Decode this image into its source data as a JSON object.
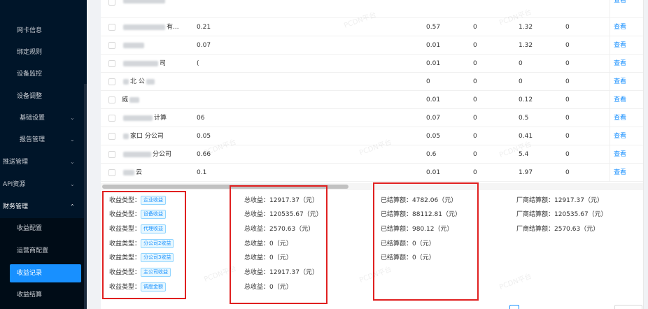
{
  "sidebar": {
    "items": [
      {
        "label": "网卡信息"
      },
      {
        "label": "绑定规则"
      },
      {
        "label": "设备监控"
      },
      {
        "label": "设备调整"
      },
      {
        "label": "基础设置"
      },
      {
        "label": "报告管理"
      },
      {
        "label": "推送管理"
      },
      {
        "label": "API资源"
      },
      {
        "label": "财务管理"
      },
      {
        "label": "收益配置"
      },
      {
        "label": "运营商配置"
      },
      {
        "label": "收益记录"
      },
      {
        "label": "收益结算"
      }
    ]
  },
  "table": {
    "action_label": "查看",
    "rows": [
      {
        "name": "有...",
        "c1": "0.21",
        "c2": "0.57",
        "c3": "0",
        "c4": "1.32",
        "c5": "0"
      },
      {
        "name": "",
        "c1": "0.07",
        "c2": "0.01",
        "c3": "0",
        "c4": "1.32",
        "c5": "0"
      },
      {
        "name": "司",
        "c1": "(",
        "c2": "0.01",
        "c3": "0",
        "c4": "0",
        "c5": "0"
      },
      {
        "name": "北 公",
        "c1": "",
        "c2": "0",
        "c3": "0",
        "c4": "0",
        "c5": "0"
      },
      {
        "name": "威",
        "c1": "",
        "c2": "0.01",
        "c3": "0",
        "c4": "0.12",
        "c5": "0"
      },
      {
        "name": "计算",
        "c1": "06",
        "c2": "0.07",
        "c3": "0",
        "c4": "0.5",
        "c5": "0"
      },
      {
        "name": "家口 分公司",
        "c1": "0.05",
        "c2": "0.05",
        "c3": "0",
        "c4": "0.41",
        "c5": "0"
      },
      {
        "name": "分公司",
        "c1": "0.66",
        "c2": "0.6",
        "c3": "0",
        "c4": "5.4",
        "c5": "0"
      },
      {
        "name": "云",
        "c1": "0.1",
        "c2": "0.01",
        "c3": "0",
        "c4": "1.97",
        "c5": "0"
      }
    ]
  },
  "summary": {
    "type_label": "收益类型：",
    "types": [
      "企业收益",
      "设备收益",
      "代理收益",
      "分公司2收益",
      "分公司3收益",
      "主公司收益",
      "调度金额"
    ],
    "totals": [
      "总收益：12917.37（元）",
      "总收益：120535.67（元）",
      "总收益：2570.63（元）",
      "总收益：0（元）",
      "总收益：0（元）",
      "总收益：12917.37（元）",
      "总收益：0（元）"
    ],
    "settled": [
      "已结算额：4782.06（元）",
      "已结算额：88112.81（元）",
      "已结算额：980.12（元）",
      "已结算额：0（元）",
      "已结算额：0（元）"
    ],
    "vendor": [
      "厂商结算额：12917.37（元）",
      "厂商结算额：120535.67（元）",
      "厂商结算额：2570.63（元）"
    ]
  },
  "watermark_text": "PCDN平台"
}
